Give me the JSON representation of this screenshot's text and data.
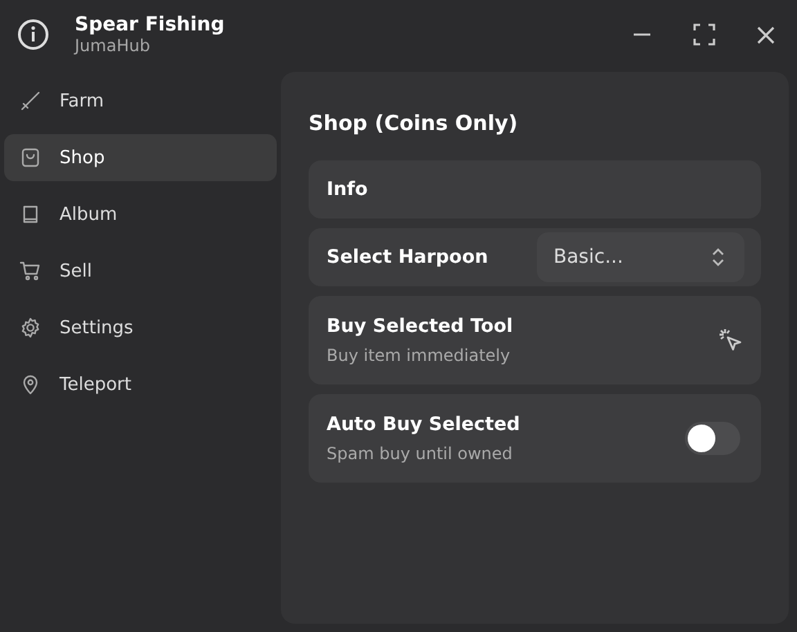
{
  "window": {
    "title": "Spear Fishing",
    "subtitle": "JumaHub"
  },
  "sidebar": {
    "items": [
      {
        "label": "Farm",
        "kind": "sword",
        "selected": false
      },
      {
        "label": "Shop",
        "kind": "bag",
        "selected": true
      },
      {
        "label": "Album",
        "kind": "book",
        "selected": false
      },
      {
        "label": "Sell",
        "kind": "cart",
        "selected": false
      },
      {
        "label": "Settings",
        "kind": "gear",
        "selected": false
      },
      {
        "label": "Teleport",
        "kind": "pin",
        "selected": false
      }
    ]
  },
  "page": {
    "title": "Shop (Coins Only)",
    "items": [
      {
        "kind": "label",
        "title": "Info"
      },
      {
        "kind": "dropdown",
        "title": "Select Harpoon",
        "value": "Basic..."
      },
      {
        "kind": "button",
        "title": "Buy Selected Tool",
        "description": "Buy item immediately"
      },
      {
        "kind": "toggle",
        "title": "Auto Buy Selected",
        "description": "Spam buy until owned",
        "on": false
      }
    ]
  }
}
